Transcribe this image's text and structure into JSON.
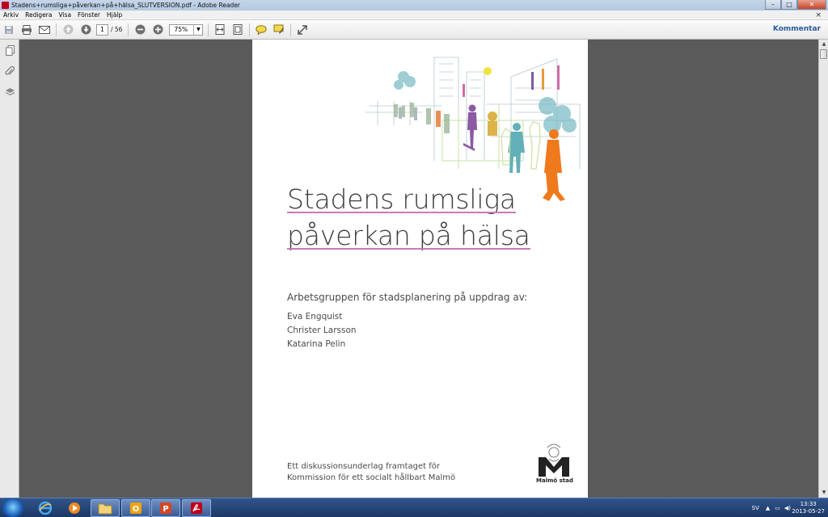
{
  "window": {
    "title": "Stadens+rumsliga+påverkan+på+hälsa_SLUTVERSION.pdf - Adobe Reader",
    "close_glyph": "✕"
  },
  "menu": {
    "items": [
      "Arkiv",
      "Redigera",
      "Visa",
      "Fönster",
      "Hjälp"
    ],
    "close_glyph": "×"
  },
  "toolbar": {
    "page_current": "1",
    "page_total": "/ 56",
    "zoom": "75%",
    "kommentar_label": "Kommentar",
    "icons": [
      "save-icon",
      "print-icon",
      "email-icon",
      "previous-page-icon",
      "next-page-icon",
      "zoom-out-icon",
      "zoom-in-icon",
      "fit-width-icon",
      "fit-page-icon",
      "comment-icon",
      "highlight-icon",
      "expand-icon"
    ]
  },
  "left_panel": {
    "icons": [
      "pages-icon",
      "attachment-icon",
      "layers-icon"
    ]
  },
  "document": {
    "title_line1": "Stadens rumsliga",
    "title_line2": "påverkan på hälsa",
    "subtitle": "Arbetsgruppen för stadsplanering på uppdrag av:",
    "authors": [
      "Eva Engquist",
      "Christer Larsson",
      "Katarina Pelin"
    ],
    "footer_line1": "Ett diskussionsunderlag framtaget för",
    "footer_line2": "Kommission för ett socialt hållbart Malmö",
    "logo_text": "Malmö stad",
    "underline_color": "#c87bb5"
  },
  "taskbar": {
    "apps": [
      "start-button",
      "internet-explorer",
      "media-player",
      "file-explorer",
      "outlook",
      "powerpoint",
      "adobe-reader"
    ],
    "language": "SV",
    "time": "13:33",
    "date": "2013-05-27"
  }
}
